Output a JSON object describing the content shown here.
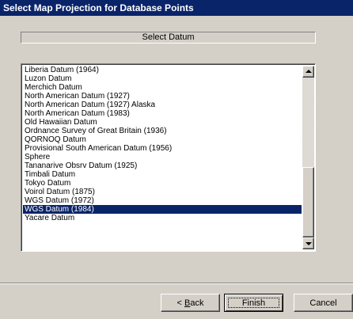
{
  "window": {
    "title": "Select Map Projection for Database Points"
  },
  "header": {
    "label": "Select Datum"
  },
  "datum_list": {
    "selected_index": 19,
    "items": [
      "Liberia Datum (1964)",
      "Luzon Datum",
      "Merchich Datum",
      "North American Datum (1927)",
      "North American Datum (1927) Alaska",
      "North American Datum (1983)",
      "Old Hawaiian Datum",
      "Ordnance Survey of Great Britain (1936)",
      "QORNOQ Datum",
      "Provisional South American Datum (1956)",
      "Sphere",
      "Tananarive Obsrv Datum (1925)",
      "Timbali Datum",
      "Tokyo Datum",
      "Voirol Datum (1875)",
      "WGS Datum (1972)",
      "WGS Datum (1984)",
      "Yacare Datum"
    ]
  },
  "buttons": {
    "back_prefix": "< ",
    "back_mnemonic": "B",
    "back_rest": "ack",
    "finish": "Finish",
    "cancel": "Cancel"
  },
  "colors": {
    "selection": "#0a246a",
    "titlebar": "#0a246a",
    "face": "#d4d0c8"
  },
  "icons": [
    "scroll-up-arrow-icon",
    "scroll-down-arrow-icon"
  ]
}
